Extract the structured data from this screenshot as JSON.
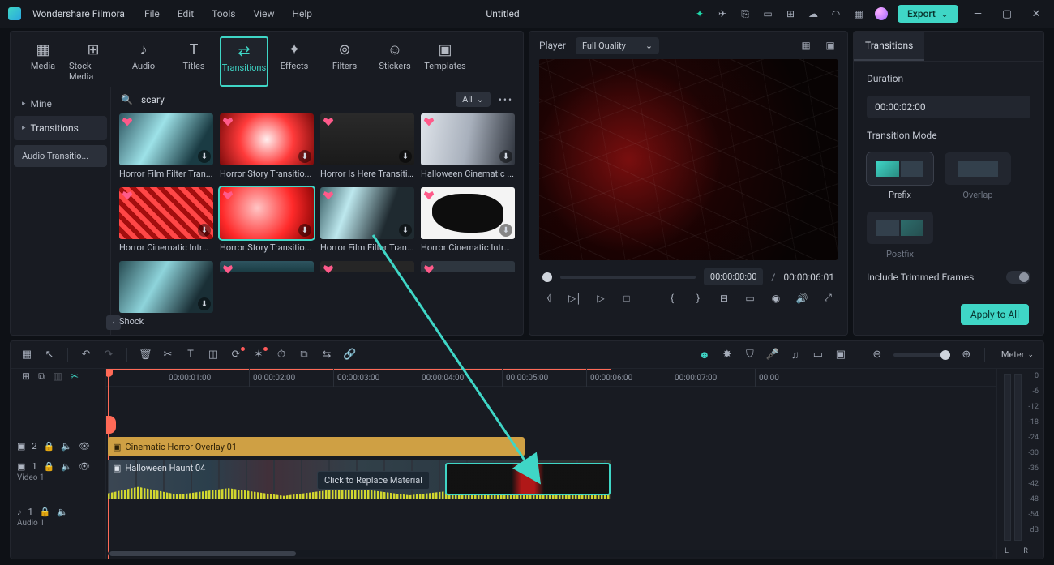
{
  "app": {
    "name": "Wondershare Filmora",
    "document": "Untitled",
    "export": "Export"
  },
  "menus": [
    "File",
    "Edit",
    "Tools",
    "View",
    "Help"
  ],
  "mediaTabs": [
    "Media",
    "Stock Media",
    "Audio",
    "Titles",
    "Transitions",
    "Effects",
    "Filters",
    "Stickers",
    "Templates"
  ],
  "mediaIcons": [
    "▦",
    "⊞",
    "♪",
    "T",
    "⇄",
    "✦",
    "⊚",
    "☺",
    "▣"
  ],
  "sidebar": {
    "mine": "Mine",
    "transitions": "Transitions",
    "sub": "Audio Transitio..."
  },
  "search": {
    "value": "scary",
    "filter": "All"
  },
  "items": [
    {
      "label": "Horror Film Filter Tran...",
      "art": "t0",
      "heart": true
    },
    {
      "label": "Horror Story Transitio...",
      "art": "t1",
      "heart": true
    },
    {
      "label": "Horror Is Here Transiti...",
      "art": "t2",
      "heart": true
    },
    {
      "label": "Halloween Cinematic ...",
      "art": "t3",
      "heart": true
    },
    {
      "label": "Horror Cinematic Intro...",
      "art": "t4",
      "heart": true
    },
    {
      "label": "Horror Story Transitio...",
      "art": "t5",
      "heart": true,
      "sel": true
    },
    {
      "label": "Horror Film Filter Tran...",
      "art": "t6",
      "heart": true
    },
    {
      "label": "Horror Cinematic Intro...",
      "art": "t7",
      "heart": true
    },
    {
      "label": "Shock",
      "art": "t8",
      "heart": false
    }
  ],
  "partials": [
    "p0",
    "p1",
    "p2"
  ],
  "player": {
    "label": "Player",
    "quality": "Full Quality",
    "time_cur": "00:00:00:00",
    "time_dur": "00:00:06:01"
  },
  "inspector": {
    "tab": "Transitions",
    "duration_label": "Duration",
    "duration_value": "00:00:02:00",
    "mode_label": "Transition Mode",
    "modes": [
      "Prefix",
      "Overlap",
      "Postfix"
    ],
    "trimmed": "Include Trimmed Frames",
    "apply": "Apply to All"
  },
  "timeline": {
    "ticks": [
      "00:00:01:00",
      "00:00:02:00",
      "00:00:03:00",
      "00:00:04:00",
      "00:00:05:00",
      "00:00:06:00",
      "00:00:07:00",
      "00:00"
    ],
    "tracks": {
      "b2": "2",
      "video": "Video 1",
      "audio": "Audio 1",
      "a1": "1",
      "v1": "1"
    },
    "overlay_clip": "Cinematic Horror Overlay 01",
    "video_clip": "Halloween Haunt 04",
    "replace": "Click to Replace Material",
    "meter": "Meter",
    "levels": [
      "0",
      "-6",
      "-12",
      "-18",
      "-24",
      "-30",
      "-36",
      "-42",
      "-48",
      "-54",
      "dB"
    ],
    "L": "L",
    "R": "R"
  },
  "colors": {
    "accent": "#3fd6c6"
  }
}
